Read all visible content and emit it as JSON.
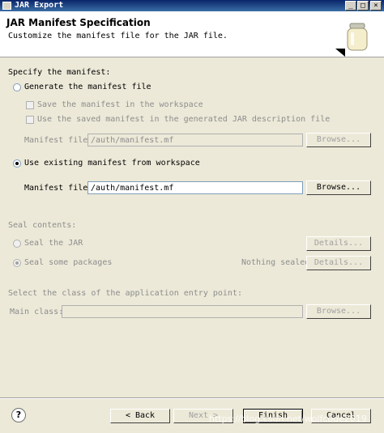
{
  "window": {
    "title": "JAR Export"
  },
  "header": {
    "title": "JAR Manifest Specification",
    "description": "Customize the manifest file for the JAR file."
  },
  "manifest": {
    "section_label": "Specify the manifest:",
    "generate_label": "Generate the manifest file",
    "save_label": "Save the manifest in the workspace",
    "reuse_label": "Use the saved manifest in the generated JAR description file",
    "generated_file_label": "Manifest file:",
    "generated_file_value": "/auth/manifest.mf",
    "browse1_label": "Browse...",
    "existing_label": "Use existing manifest from workspace",
    "existing_file_label": "Manifest file:",
    "existing_file_value": "/auth/manifest.mf",
    "browse2_label": "Browse..."
  },
  "seal": {
    "section_label": "Seal contents:",
    "seal_jar_label": "Seal the JAR",
    "details1_label": "Details...",
    "seal_packages_label": "Seal some packages",
    "status": "Nothing sealed",
    "details2_label": "Details..."
  },
  "entry": {
    "section_label": "Select the class of the application entry point:",
    "main_class_label": "Main class:",
    "main_class_value": "",
    "browse_label": "Browse..."
  },
  "footer": {
    "back_label": "< Back",
    "next_label": "Next >",
    "finish_label": "Finish",
    "cancel_label": "Cancel"
  },
  "watermark": "https://blog.csdn.net/wolfcode2019"
}
